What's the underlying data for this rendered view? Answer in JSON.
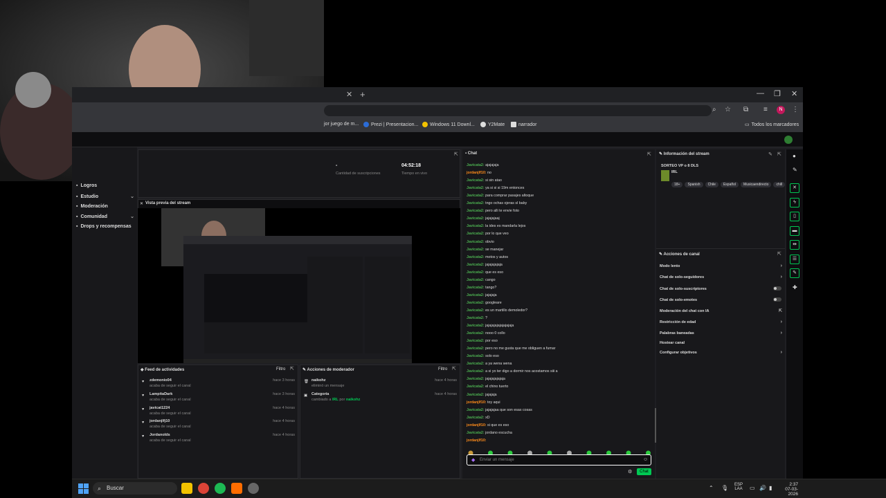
{
  "browser": {
    "bookmarks": [
      {
        "label": "jor juego de m...",
        "color": "#666"
      },
      {
        "label": "Prezi | Presentacion...",
        "color": "#2b6cd6"
      },
      {
        "label": "Windows 11 Downl...",
        "color": "#f2c200"
      },
      {
        "label": "Y2Mate",
        "color": "#ddd"
      },
      {
        "label": "narrador",
        "color": "#ddd"
      }
    ],
    "all_bookmarks": "Todos los marcadores",
    "profile_initial": "N"
  },
  "sidebar": {
    "items": [
      {
        "label": "Logros",
        "chevron": false
      },
      {
        "label": "Estudio",
        "chevron": true
      },
      {
        "label": "Moderación",
        "chevron": false
      },
      {
        "label": "Comunidad",
        "chevron": true
      },
      {
        "label": "Drops y recompensas",
        "chevron": false
      }
    ]
  },
  "stats": {
    "dash": "-",
    "subs_label": "Cantidad de suscripciones",
    "live_time": "04:52:18",
    "live_label": "Tiempo en vivo"
  },
  "preview": {
    "title": "Vista previa del stream"
  },
  "activity": {
    "title": "Feed de actividades",
    "filter": "Filtro",
    "items": [
      {
        "name": "zdemonio04",
        "sub": "acaba de seguir el canal",
        "time": "hace 3 horas"
      },
      {
        "name": "LampitaDark",
        "sub": "acaba de seguir el canal",
        "time": "hace 3 horas"
      },
      {
        "name": "javicat1224",
        "sub": "acaba de seguir el canal",
        "time": "hace 4 horas"
      },
      {
        "name": "jordanjlfj10",
        "sub": "acaba de seguir el canal",
        "time": "hace 4 horas"
      },
      {
        "name": "Jordanolds",
        "sub": "acaba de seguir el canal",
        "time": "hace 4 horas"
      }
    ]
  },
  "mod_actions": {
    "title": "Acciones de moderador",
    "filter": "Filtro",
    "items": [
      {
        "name": "naikohz",
        "sub": "eliminó un mensaje",
        "time": "hace 4 horas"
      },
      {
        "name": "Categoría",
        "sub_prefix": "cambiado a",
        "sub_value": "IRL",
        "sub_mid": "por",
        "sub_by": "naikohz",
        "time": "hace 4 horas"
      }
    ]
  },
  "chat": {
    "title": "Chat",
    "lines": [
      {
        "user": "Javicata2:",
        "text": "ajajajaja",
        "color": "#4caf50"
      },
      {
        "user": "jordanjlf10:",
        "text": "no",
        "color": "#ff8c1a"
      },
      {
        "user": "Javicata2:",
        "text": "si sin atao",
        "color": "#4caf50"
      },
      {
        "user": "Javicata2:",
        "text": "ya si si si 19m entonces",
        "color": "#4caf50"
      },
      {
        "user": "Javicata2:",
        "text": "para comprar pasajes altoque",
        "color": "#4caf50"
      },
      {
        "user": "Javicata2:",
        "text": "tngo ochas ojeras sl baby",
        "color": "#4caf50"
      },
      {
        "user": "Javicata2:",
        "text": "pero alli te envie foto",
        "color": "#4caf50"
      },
      {
        "user": "Javicata2:",
        "text": "jajajajaaj",
        "color": "#4caf50"
      },
      {
        "user": "Javicata2:",
        "text": "la ides es mandarla lejos",
        "color": "#4caf50"
      },
      {
        "user": "Javicata2:",
        "text": "por lo que veo",
        "color": "#4caf50"
      },
      {
        "user": "Javicata2:",
        "text": "obvio",
        "color": "#4caf50"
      },
      {
        "user": "Javicata2:",
        "text": "se manejar",
        "color": "#4caf50"
      },
      {
        "user": "Javicata2:",
        "text": "motos y autos",
        "color": "#4caf50"
      },
      {
        "user": "Javicata2:",
        "text": "jajajajajaja",
        "color": "#4caf50"
      },
      {
        "user": "Javicata2:",
        "text": "que es eso",
        "color": "#4caf50"
      },
      {
        "user": "Javicata2:",
        "text": "cango",
        "color": "#4caf50"
      },
      {
        "user": "Javicata2:",
        "text": "tango?",
        "color": "#4caf50"
      },
      {
        "user": "Javicata2:",
        "text": "jajajaja",
        "color": "#4caf50"
      },
      {
        "user": "Javicata2:",
        "text": "googleare",
        "color": "#4caf50"
      },
      {
        "user": "Javicata2:",
        "text": "es un martillo demoledor?",
        "color": "#4caf50"
      },
      {
        "user": "Javicata2:",
        "text": "?",
        "color": "#4caf50"
      },
      {
        "user": "Javicata2:",
        "text": "jajajajajajajajajaja",
        "color": "#4caf50"
      },
      {
        "user": "Javicata2:",
        "text": "nooo 0 collo",
        "color": "#4caf50"
      },
      {
        "user": "Javicata2:",
        "text": "por eso",
        "color": "#4caf50"
      },
      {
        "user": "Javicata2:",
        "text": "pero no me gusta que me obliguen a fumar",
        "color": "#4caf50"
      },
      {
        "user": "Javicata2:",
        "text": "solo eso",
        "color": "#4caf50"
      },
      {
        "user": "Javicata2:",
        "text": "a ya wena wena",
        "color": "#4caf50"
      },
      {
        "user": "Javicata2:",
        "text": "a si yo ter digo a dormir nos acostamos siii a",
        "color": "#4caf50"
      },
      {
        "user": "Javicata2:",
        "text": "jajajajajajaja",
        "color": "#4caf50"
      },
      {
        "user": "Javicata2:",
        "text": "el chino tuerto",
        "color": "#4caf50"
      },
      {
        "user": "Javicata2:",
        "text": "jajajaja",
        "color": "#4caf50"
      },
      {
        "user": "jordanjlf10:",
        "text": "toy aqui",
        "color": "#ff8c1a"
      },
      {
        "user": "Javicata2:",
        "text": "jajajajaa que son esas cosas",
        "color": "#4caf50"
      },
      {
        "user": "Javicata2:",
        "text": "xD",
        "color": "#4caf50"
      },
      {
        "user": "jordanjlf10:",
        "text": "si que es eso",
        "color": "#ff8c1a"
      },
      {
        "user": "Javicata2:",
        "text": "jordano escucha",
        "color": "#4caf50"
      },
      {
        "user": "jordanjlf10:",
        "text": "",
        "color": "#ff8c1a"
      }
    ],
    "input_placeholder": "Enviar un mensaje",
    "send_label": "Chat"
  },
  "stream_info": {
    "title": "Información del stream",
    "stream_title": "SORTEO VP o 8 DLS",
    "category": "IRL",
    "tags": [
      "18+",
      "Spanish",
      "Chile",
      "Español",
      "Musicaendirecto",
      "chill"
    ]
  },
  "channel_actions": {
    "title": "Acciones de canal",
    "items": [
      {
        "label": "Modo lento",
        "control": "chevron"
      },
      {
        "label": "Chat de solo-seguidores",
        "control": "chevron"
      },
      {
        "label": "Chat de solo-suscriptores",
        "control": "toggle"
      },
      {
        "label": "Chat de solo-emotes",
        "control": "toggle"
      },
      {
        "label": "Moderación del chat con IA",
        "control": "external"
      },
      {
        "label": "Restricción de edad",
        "control": "chevron"
      },
      {
        "label": "Palabras baneadas",
        "control": "chevron"
      },
      {
        "label": "Hostear canal",
        "control": "none"
      },
      {
        "label": "Configurar objetivos",
        "control": "chevron"
      }
    ]
  },
  "taskbar": {
    "search_label": "Buscar",
    "lang_top": "ESP",
    "lang_bottom": "LAA",
    "time": "2:37",
    "date": "07-03-2026"
  },
  "colors": {
    "accent": "#00c853",
    "chat_user_green": "#4caf50",
    "chat_user_orange": "#ff8c1a"
  }
}
